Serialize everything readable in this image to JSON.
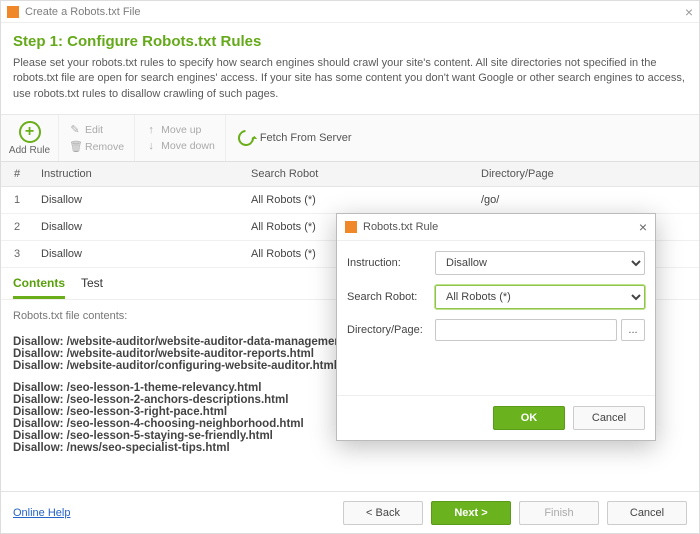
{
  "titlebar": {
    "title": "Create a Robots.txt File"
  },
  "header": {
    "step_title": "Step 1: Configure Robots.txt Rules",
    "hint": "Please set your robots.txt rules to specify how search engines should crawl your site's content. All site directories not specified in the robots.txt file are open for search engines' access. If your site has some content you don't want Google or other search engines to access, use robots.txt rules to disallow crawling of such pages."
  },
  "toolbar": {
    "add_label": "Add Rule",
    "edit": "Edit",
    "remove": "Remove",
    "move_up": "Move up",
    "move_down": "Move down",
    "fetch": "Fetch From Server"
  },
  "table": {
    "headers": {
      "num": "#",
      "instr": "Instruction",
      "robot": "Search Robot",
      "dir": "Directory/Page"
    },
    "rows": [
      {
        "num": "1",
        "instr": "Disallow",
        "robot": "All Robots (*)",
        "dir": "/go/"
      },
      {
        "num": "2",
        "instr": "Disallow",
        "robot": "All Robots (*)",
        "dir": ""
      },
      {
        "num": "3",
        "instr": "Disallow",
        "robot": "All Robots (*)",
        "dir": ""
      }
    ]
  },
  "tabs": {
    "contents": "Contents",
    "test": "Test"
  },
  "contents": {
    "label": "Robots.txt file contents:",
    "lines_a": [
      "Disallow: /website-auditor/website-auditor-data-management.html",
      "Disallow: /website-auditor/website-auditor-reports.html",
      "Disallow: /website-auditor/configuring-website-auditor.html"
    ],
    "lines_b": [
      "Disallow: /seo-lesson-1-theme-relevancy.html",
      "Disallow: /seo-lesson-2-anchors-descriptions.html",
      "Disallow: /seo-lesson-3-right-pace.html",
      "Disallow: /seo-lesson-4-choosing-neighborhood.html",
      "Disallow: /seo-lesson-5-staying-se-friendly.html",
      "Disallow: /news/seo-specialist-tips.html"
    ]
  },
  "modal": {
    "title": "Robots.txt Rule",
    "labels": {
      "instr": "Instruction:",
      "robot": "Search Robot:",
      "dir": "Directory/Page:"
    },
    "values": {
      "instr": "Disallow",
      "robot": "All Robots (*)",
      "dir": ""
    },
    "buttons": {
      "ok": "OK",
      "cancel": "Cancel"
    },
    "browse": "..."
  },
  "footer": {
    "help": "Online Help",
    "back": "< Back",
    "next": "Next >",
    "finish": "Finish",
    "cancel": "Cancel"
  }
}
